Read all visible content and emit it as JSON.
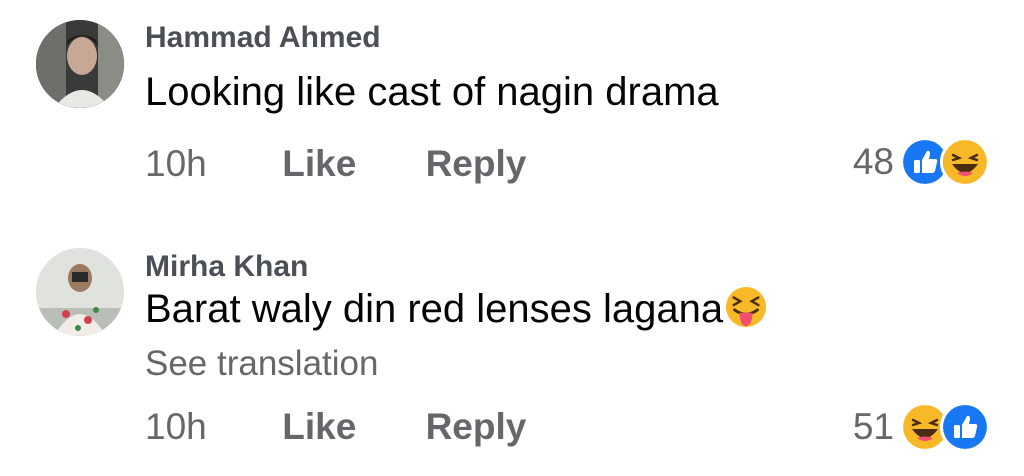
{
  "comments": [
    {
      "author": "Hammad Ahmed",
      "text": "Looking like cast of nagin drama",
      "time": "10h",
      "like_label": "Like",
      "reply_label": "Reply",
      "reaction_count": "48",
      "reactions": [
        "like-icon",
        "haha-icon"
      ]
    },
    {
      "author": "Mirha Khan",
      "text": "Barat waly din red lenses lagana",
      "inline_emoji": "squinting-tongue-emoji",
      "see_translation": "See translation",
      "time": "10h",
      "like_label": "Like",
      "reply_label": "Reply",
      "reaction_count": "51",
      "reactions": [
        "haha-icon",
        "like-icon"
      ]
    }
  ],
  "colors": {
    "like_blue": "#1877f2",
    "emoji_yellow": "#f7b928",
    "secondary_text": "#65676b",
    "author_text": "#4b4f56"
  }
}
